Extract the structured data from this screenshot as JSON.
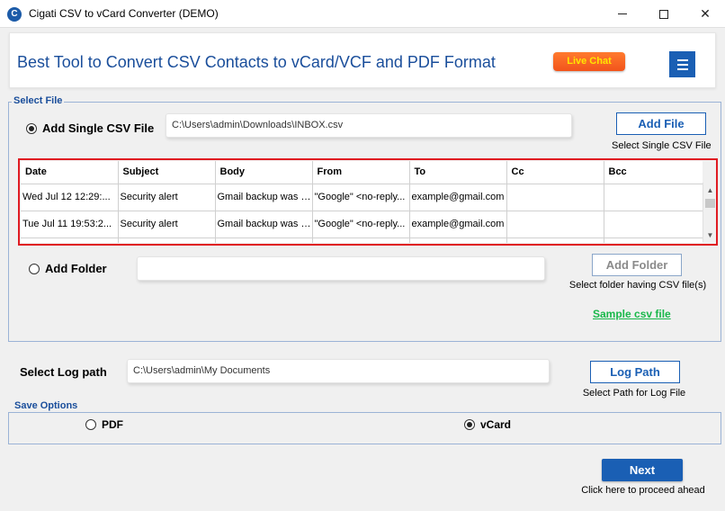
{
  "window": {
    "title": "Cigati CSV to vCard Converter (DEMO)",
    "icon_letter": "C",
    "minimize": "minimize",
    "maximize": "maximize",
    "close": "✕"
  },
  "header": {
    "title": "Best Tool to Convert CSV Contacts to vCard/VCF and PDF Format",
    "live_chat": "Live Chat"
  },
  "select_file": {
    "legend": "Select File",
    "single": {
      "label": "Add Single CSV File",
      "checked": true,
      "path": "C:\\Users\\admin\\Downloads\\INBOX.csv",
      "button": "Add File",
      "hint": "Select Single CSV File"
    },
    "grid": {
      "columns": [
        "Date",
        "Subject",
        "Body",
        "From",
        "To",
        "Cc",
        "Bcc"
      ],
      "rows": [
        [
          "Wed Jul 12 12:29:...",
          "Security alert",
          "Gmail backup was g...",
          "\"Google\" <no-reply...",
          "example@gmail.com",
          "",
          ""
        ],
        [
          "Tue Jul 11 19:53:2...",
          "Security alert",
          "Gmail backup was g...",
          "\"Google\" <no-reply...",
          "example@gmail.com",
          "",
          ""
        ]
      ]
    },
    "folder": {
      "label": "Add Folder",
      "checked": false,
      "path": "",
      "button": "Add Folder",
      "hint": "Select folder having CSV file(s)"
    },
    "sample_link": "Sample csv file"
  },
  "log": {
    "label": "Select Log path",
    "path": "C:\\Users\\admin\\My Documents",
    "button": "Log Path",
    "hint": "Select Path for Log File"
  },
  "save_options": {
    "legend": "Save Options",
    "pdf": {
      "label": "PDF",
      "checked": false
    },
    "vcard": {
      "label": "vCard",
      "checked": true
    }
  },
  "next": {
    "button": "Next",
    "hint": "Click here to proceed ahead"
  },
  "colors": {
    "brand_blue": "#1a5fb4",
    "title_blue": "#1a4e9b",
    "highlight_red": "#e01b22",
    "link_green": "#18b84a",
    "chat_orange": "#f2541b"
  }
}
